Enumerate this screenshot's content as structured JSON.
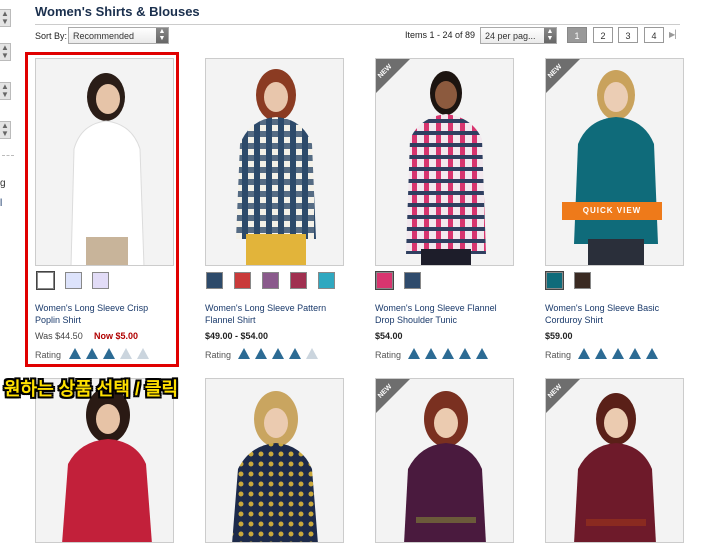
{
  "page_title": "Women's Shirts & Blouses",
  "left_sidebar": {
    "texts": [
      "g",
      "l"
    ]
  },
  "sort": {
    "label": "Sort By:",
    "value": "Recommended"
  },
  "items_count": "Items 1 - 24 of 89",
  "per_page": {
    "value": "24 per pag..."
  },
  "pagination": {
    "pages": [
      "1",
      "2",
      "3",
      "4"
    ],
    "active": "1"
  },
  "quick_view_label": "QUICK VIEW",
  "new_badge_label": "NEW",
  "rating_label": "Rating",
  "annotation": "원하는 상품 선택 / 클릭",
  "products": [
    {
      "name": "Women's Long Sleeve Crisp Poplin Shirt",
      "price_was": "Was $44.50",
      "price_now": "Now $5.00",
      "rating": 3.5,
      "new": false,
      "swatches": [
        "#ffffff",
        "#dde3fb",
        "#e2dcf7"
      ]
    },
    {
      "name": "Women's Long Sleeve Pattern Flannel Shirt",
      "price": "$49.00 - $54.00",
      "rating": 4.5,
      "new": false,
      "swatches": [
        "#2d4a6a",
        "#c93a3a",
        "#8a5a8c",
        "#a03050",
        "#2fa8c0"
      ]
    },
    {
      "name": "Women's Long Sleeve Flannel Drop Shoulder Tunic",
      "price": "$54.00",
      "rating": 5,
      "new": true,
      "swatches": [
        "#d8356f",
        "#2f4b6c"
      ]
    },
    {
      "name": "Women's Long Sleeve Basic Corduroy Shirt",
      "price": "$59.00",
      "rating": 5,
      "new": true,
      "swatches": [
        "#0f6b7a",
        "#3a2a22"
      ]
    }
  ],
  "row2_new": [
    false,
    false,
    true,
    true
  ],
  "colors": {
    "title": "#1a2f4d",
    "link": "#1a3a6b",
    "sale": "#b00000",
    "highlight": "#e00000",
    "quick_view": "#ee7a1a",
    "rating_icon": "#2c6b94",
    "annotation": "#ffe000"
  }
}
